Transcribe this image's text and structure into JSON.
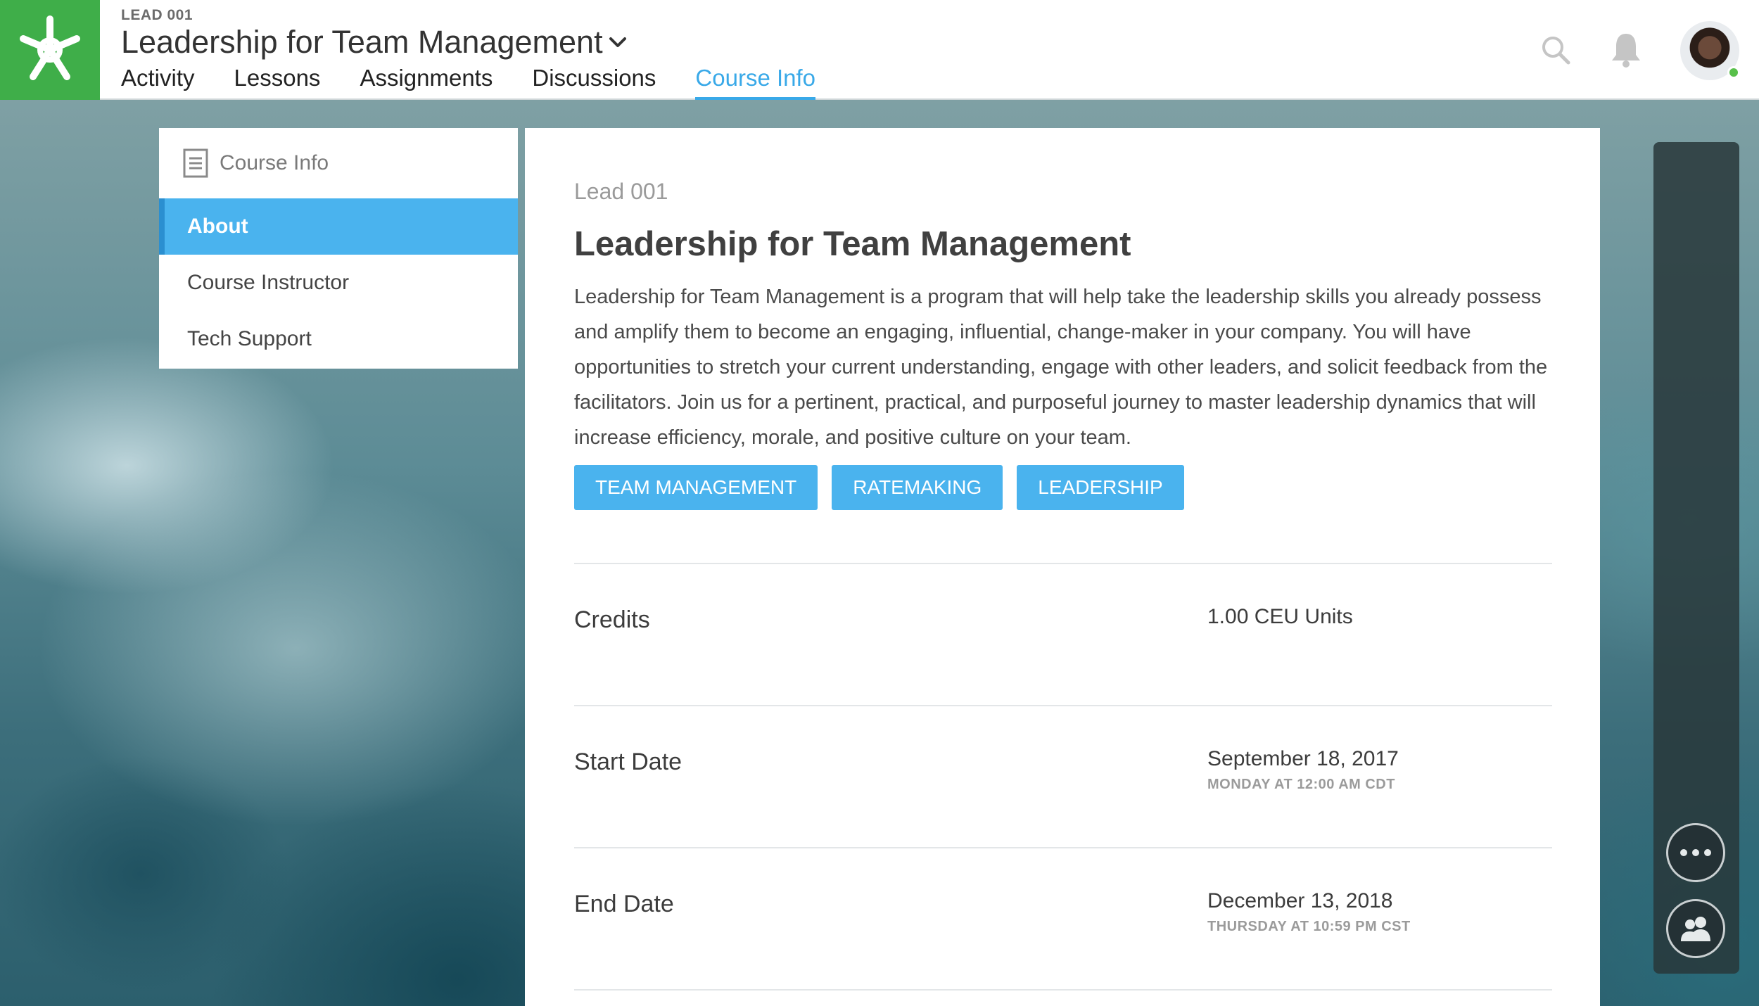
{
  "header": {
    "course_code": "LEAD 001",
    "course_title": "Leadership for Team Management",
    "tabs": [
      {
        "label": "Activity"
      },
      {
        "label": "Lessons"
      },
      {
        "label": "Assignments"
      },
      {
        "label": "Discussions"
      },
      {
        "label": "Course Info",
        "active": true
      }
    ],
    "icons": [
      "search-icon",
      "bell-icon",
      "user-avatar"
    ]
  },
  "sidebar": {
    "title": "Course Info",
    "items": [
      {
        "label": "About",
        "active": true
      },
      {
        "label": "Course Instructor"
      },
      {
        "label": "Tech Support"
      }
    ]
  },
  "main": {
    "code": "Lead 001",
    "title": "Leadership for Team Management",
    "description": "Leadership for Team Management is a program that will help take the leadership skills you already possess and amplify them to become an engaging, influential, change-maker in your company. You will have opportunities to stretch your current understanding, engage with other leaders, and solicit feedback from the facilitators. Join us for a pertinent, practical, and purposeful journey to master leadership dynamics that will increase efficiency, morale, and positive culture on your team.",
    "tags": [
      "TEAM MANAGEMENT",
      "RATEMAKING",
      "LEADERSHIP"
    ],
    "details": [
      {
        "label": "Credits",
        "value": "1.00 CEU Units",
        "sub": ""
      },
      {
        "label": "Start Date",
        "value": "September 18, 2017",
        "sub": "MONDAY AT 12:00 AM CDT"
      },
      {
        "label": "End Date",
        "value": "December 13, 2018",
        "sub": "THURSDAY AT 10:59 PM CST"
      }
    ]
  },
  "colors": {
    "brand_green": "#3fae49",
    "accent_blue": "#4ab3ee",
    "active_tab": "#39a9e8"
  }
}
